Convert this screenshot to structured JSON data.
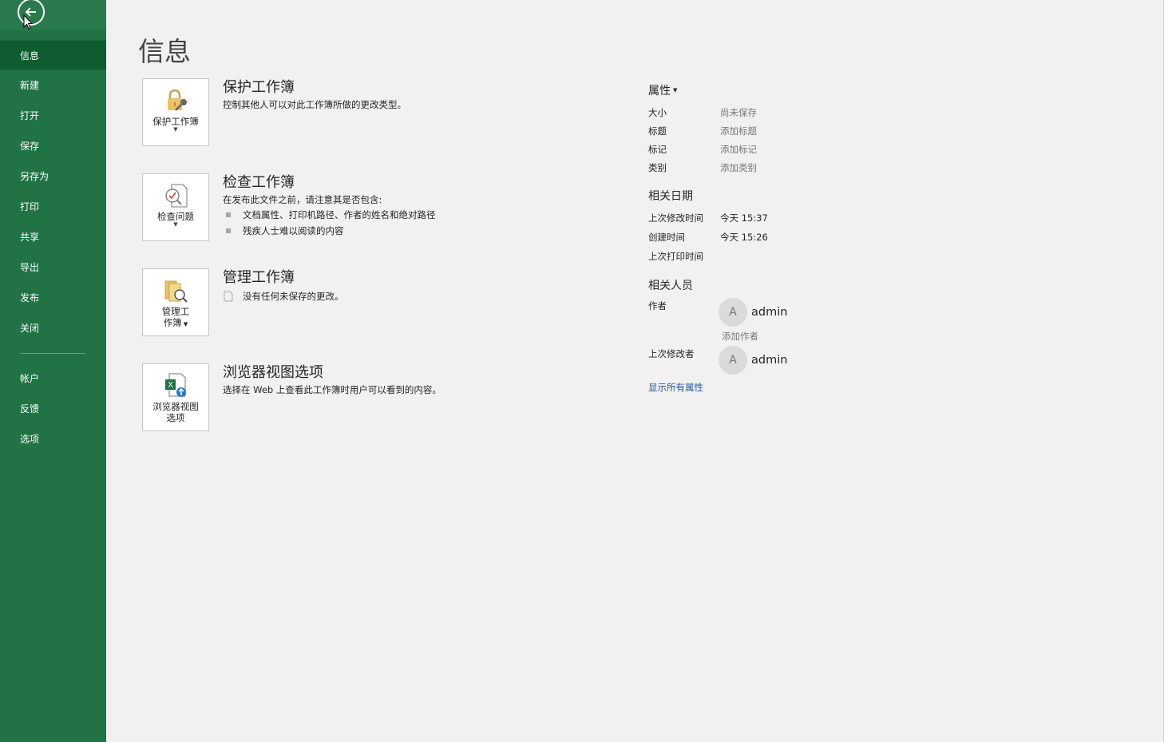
{
  "sidebar": {
    "items": [
      {
        "label": "信息",
        "active": true
      },
      {
        "label": "新建"
      },
      {
        "label": "打开"
      },
      {
        "label": "保存"
      },
      {
        "label": "另存为"
      },
      {
        "label": "打印"
      },
      {
        "label": "共享"
      },
      {
        "label": "导出"
      },
      {
        "label": "发布"
      },
      {
        "label": "关闭"
      }
    ],
    "bottom_items": [
      {
        "label": "帐户"
      },
      {
        "label": "反馈"
      },
      {
        "label": "选项"
      }
    ]
  },
  "main": {
    "title": "信息",
    "sections": [
      {
        "tile_label": "保护工作簿",
        "title": "保护工作簿",
        "desc": "控制其他人可以对此工作簿所做的更改类型。"
      },
      {
        "tile_label": "检查问题",
        "title": "检查工作簿",
        "desc": "在发布此文件之前，请注意其是否包含:",
        "bullets": [
          "文档属性、打印机路径、作者的姓名和绝对路径",
          "残疾人士难以阅读的内容"
        ]
      },
      {
        "tile_label_1": "管理工",
        "tile_label_2": "作簿",
        "title": "管理工作簿",
        "desc": "没有任何未保存的更改。"
      },
      {
        "tile_label_1": "浏览器视图",
        "tile_label_2": "选项",
        "title": "浏览器视图选项",
        "desc": "选择在 Web 上查看此工作簿时用户可以看到的内容。"
      }
    ]
  },
  "properties": {
    "header": "属性",
    "rows": [
      {
        "key": "大小",
        "value": "尚未保存"
      },
      {
        "key": "标题",
        "value": "添加标题"
      },
      {
        "key": "标记",
        "value": "添加标记"
      },
      {
        "key": "类别",
        "value": "添加类别"
      }
    ],
    "dates_title": "相关日期",
    "dates": [
      {
        "key": "上次修改时间",
        "value": "今天 15:37"
      },
      {
        "key": "创建时间",
        "value": "今天 15:26"
      },
      {
        "key": "上次打印时间",
        "value": ""
      }
    ],
    "people_title": "相关人员",
    "author_key": "作者",
    "author_initial": "A",
    "author_name": "admin",
    "add_author": "添加作者",
    "modifier_key": "上次修改者",
    "modifier_initial": "A",
    "modifier_name": "admin",
    "show_all": "显示所有属性"
  },
  "colors": {
    "sidebar": "#217346",
    "active": "#0e5c2f",
    "link": "#2b579a"
  }
}
